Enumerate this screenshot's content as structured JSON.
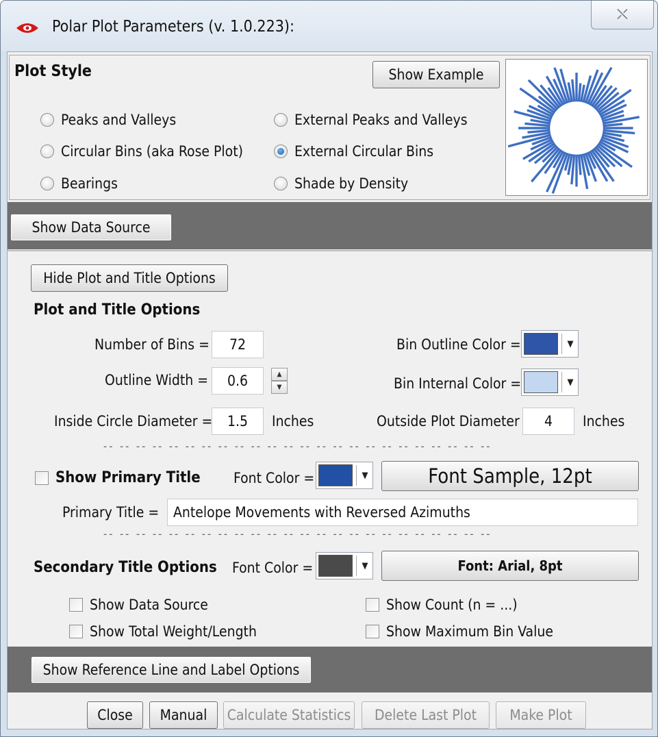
{
  "window": {
    "title": "Polar Plot Parameters (v. 1.0.223):",
    "close_glyph": "⛌"
  },
  "plot_style": {
    "heading": "Plot Style",
    "show_example_label": "Show Example",
    "options": {
      "peaks_valleys": "Peaks and Valleys",
      "circular_bins": "Circular Bins (aka Rose Plot)",
      "bearings": "Bearings",
      "ext_peaks_valleys": "External Peaks and Valleys",
      "ext_circular_bins": "External Circular Bins",
      "shade_density": "Shade by Density"
    },
    "selected": "ext_circular_bins",
    "preview_color": "#3e6fc2"
  },
  "data_source": {
    "button_label": "Show Data Source"
  },
  "plot_title": {
    "toggle_label": "Hide Plot and Title Options",
    "heading": "Plot and Title Options",
    "num_bins_label": "Number of Bins =",
    "num_bins_value": "72",
    "outline_width_label": "Outline Width =",
    "outline_width_value": "0.6",
    "inside_diam_label": "Inside Circle Diameter =",
    "inside_diam_value": "1.5",
    "inches_1": "Inches",
    "bin_outline_label": "Bin Outline Color =",
    "bin_outline_color": "#2f55a8",
    "bin_internal_label": "Bin Internal Color =",
    "bin_internal_color": "#c3d7f0",
    "outside_diam_label": "Outside Plot Diameter",
    "outside_diam_value": "4",
    "inches_2": "Inches",
    "dashes": "-- -- -- -- -- -- -- -- -- -- -- -- -- -- -- -- -- -- -- -- -- -- -- --",
    "show_primary_label": "Show Primary Title",
    "primary_font_color_label": "Font Color =",
    "primary_font_color": "#2250a4",
    "primary_font_sample": "Font Sample, 12pt",
    "primary_title_label": "Primary Title =",
    "primary_title_value": "Antelope Movements with Reversed Azimuths",
    "secondary_heading": "Secondary Title Options",
    "secondary_font_color_label": "Font Color =",
    "secondary_font_color": "#4a4a4a",
    "secondary_font_sample": "Font: Arial, 8pt",
    "show_data_source": "Show Data Source",
    "show_total_weight": "Show Total Weight/Length",
    "show_count": "Show Count (n = ...)",
    "show_max_bin": "Show Maximum Bin Value"
  },
  "reference": {
    "button_label": "Show Reference Line and Label Options"
  },
  "footer": {
    "close": "Close",
    "manual": "Manual",
    "calc_stats": "Calculate Statistics",
    "delete_last": "Delete Last Plot",
    "make_plot": "Make Plot"
  }
}
